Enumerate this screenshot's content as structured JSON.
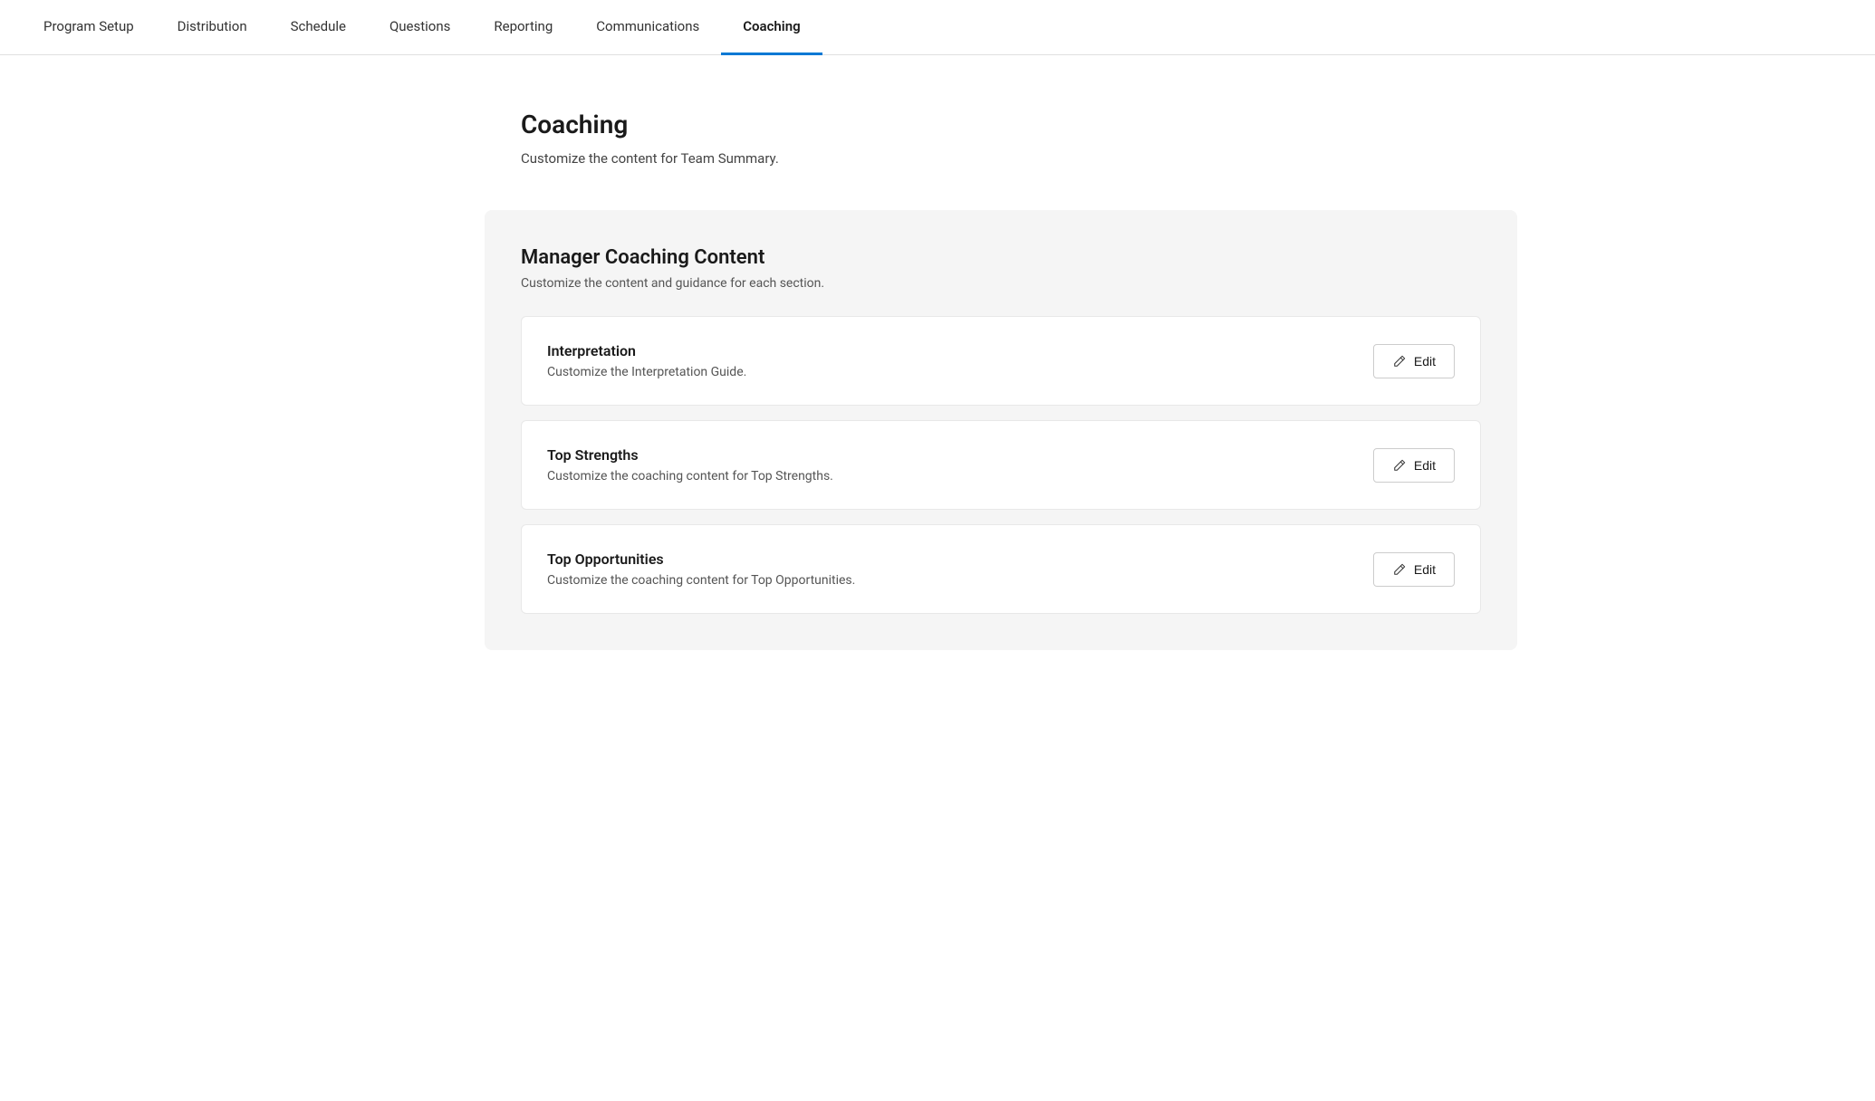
{
  "nav": {
    "items": [
      {
        "id": "program-setup",
        "label": "Program Setup",
        "active": false
      },
      {
        "id": "distribution",
        "label": "Distribution",
        "active": false
      },
      {
        "id": "schedule",
        "label": "Schedule",
        "active": false
      },
      {
        "id": "questions",
        "label": "Questions",
        "active": false
      },
      {
        "id": "reporting",
        "label": "Reporting",
        "active": false
      },
      {
        "id": "communications",
        "label": "Communications",
        "active": false
      },
      {
        "id": "coaching",
        "label": "Coaching",
        "active": true
      }
    ]
  },
  "page": {
    "title": "Coaching",
    "subtitle": "Customize the content for Team Summary."
  },
  "coaching_card": {
    "title": "Manager Coaching Content",
    "subtitle": "Customize the content and guidance for each section.",
    "sections": [
      {
        "id": "interpretation",
        "title": "Interpretation",
        "description": "Customize the Interpretation Guide.",
        "edit_label": "Edit"
      },
      {
        "id": "top-strengths",
        "title": "Top Strengths",
        "description": "Customize the coaching content for Top Strengths.",
        "edit_label": "Edit"
      },
      {
        "id": "top-opportunities",
        "title": "Top Opportunities",
        "description": "Customize the coaching content for Top Opportunities.",
        "edit_label": "Edit"
      }
    ]
  },
  "colors": {
    "active_underline": "#0078d4"
  }
}
